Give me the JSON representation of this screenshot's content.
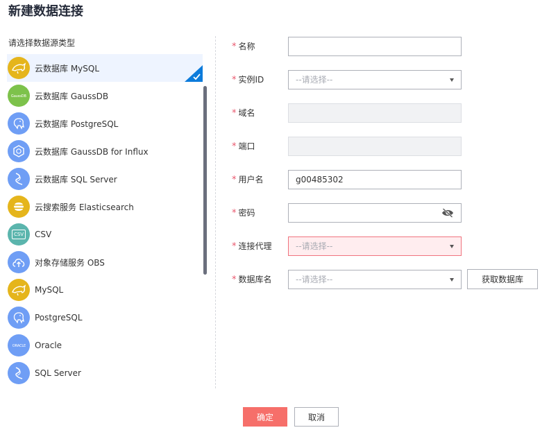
{
  "dialog": {
    "title": "新建数据连接"
  },
  "sources": {
    "label": "请选择数据源类型",
    "items": [
      {
        "name": "云数据库 MySQL",
        "icon": "dolphin-icon",
        "color": "#e5b51c",
        "selected": true
      },
      {
        "name": "云数据库 GaussDB",
        "icon": "gaussdb-logo-icon",
        "icon_text": "GaussDB",
        "color": "#7dc24b"
      },
      {
        "name": "云数据库 PostgreSQL",
        "icon": "elephant-icon",
        "color": "#6f9ef5"
      },
      {
        "name": "云数据库 GaussDB for Influx",
        "icon": "hexagon-icon",
        "color": "#6f9ef5"
      },
      {
        "name": "云数据库 SQL Server",
        "icon": "sqlserver-icon",
        "color": "#6f9ef5"
      },
      {
        "name": "云搜索服务 Elasticsearch",
        "icon": "elasticsearch-icon",
        "color": "#e5b51c"
      },
      {
        "name": "CSV",
        "icon": "csv-file-icon",
        "icon_text": "CSV",
        "color": "#5bb5ad"
      },
      {
        "name": "对象存储服务 OBS",
        "icon": "cloud-upload-icon",
        "color": "#6f9ef5"
      },
      {
        "name": "MySQL",
        "icon": "dolphin-icon",
        "color": "#e5b51c"
      },
      {
        "name": "PostgreSQL",
        "icon": "elephant-icon",
        "color": "#6f9ef5"
      },
      {
        "name": "Oracle",
        "icon": "oracle-logo-icon",
        "icon_text": "ORACLE",
        "color": "#6f9ef5"
      },
      {
        "name": "SQL Server",
        "icon": "sqlserver-icon",
        "color": "#6f9ef5"
      }
    ]
  },
  "form": {
    "required_mark": "*",
    "name": {
      "label": "名称",
      "value": ""
    },
    "instance_id": {
      "label": "实例ID",
      "placeholder": "--请选择--"
    },
    "domain": {
      "label": "域名",
      "value": ""
    },
    "port": {
      "label": "端口",
      "value": ""
    },
    "username": {
      "label": "用户名",
      "value": "g00485302"
    },
    "password": {
      "label": "密码",
      "value": ""
    },
    "proxy": {
      "label": "连接代理",
      "placeholder": "--请选择--"
    },
    "database": {
      "label": "数据库名",
      "placeholder": "--请选择--",
      "fetch_label": "获取数据库"
    }
  },
  "footer": {
    "ok_label": "确定",
    "cancel_label": "取消"
  },
  "colors": {
    "accent": "#0c7bdb",
    "primary_button": "#f66f6a",
    "required": "#e9576d",
    "error_bg": "#ffedef",
    "error_border": "#f0737e",
    "selected_bg": "#eef4ff"
  }
}
